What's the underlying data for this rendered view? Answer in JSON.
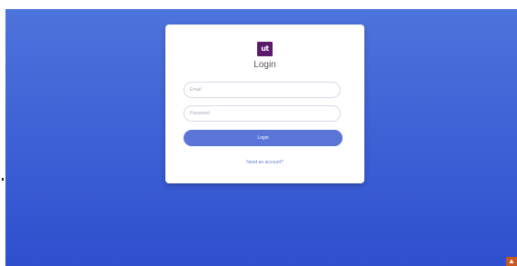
{
  "login_card": {
    "logo_text": "ut",
    "title": "Login",
    "email_placeholder": "Email",
    "password_placeholder": "Password",
    "login_button_label": "Login",
    "signup_link_text": "Need an account?"
  },
  "colors": {
    "background_top": "#4d74dc",
    "background_bottom": "#2f4fcf",
    "button": "#5b74d8",
    "logo": "#5b1a6b",
    "corner_icon": "#c8581f"
  },
  "corner_icon": {
    "name": "warning-icon",
    "glyph": "▲"
  }
}
